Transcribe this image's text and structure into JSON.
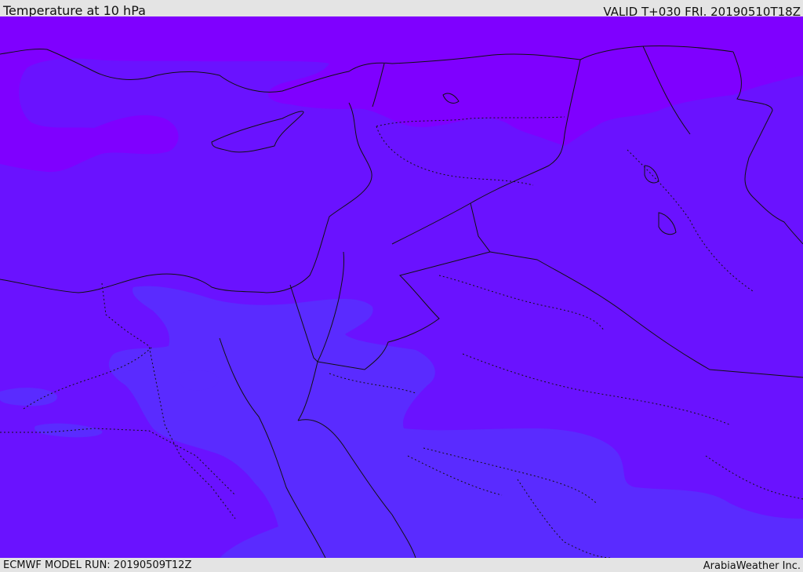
{
  "header": {
    "title": "Temperature at 10 hPa",
    "valid": "VALID T+030 FRI. 20190510T18Z"
  },
  "footer": {
    "model_run": "ECMWF MODEL RUN: 20190509T12Z",
    "credit": "ArabiaWeather Inc."
  },
  "map": {
    "colors": {
      "warm_band": "#7f00ff",
      "mid_band": "#6a12ff",
      "cool_band": "#5a2bff",
      "borders": "#111111"
    }
  }
}
